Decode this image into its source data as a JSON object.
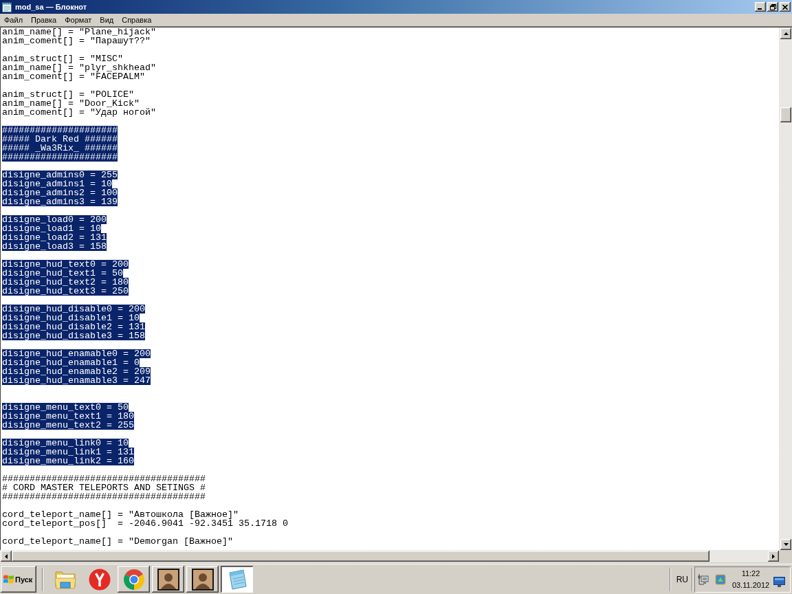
{
  "window": {
    "title": "mod_sa — Блокнот"
  },
  "menu": [
    "Файл",
    "Правка",
    "Формат",
    "Вид",
    "Справка"
  ],
  "editor": {
    "lines": [
      {
        "kind": "text",
        "text": "anim_name[] = \"Plane_hijack\"",
        "selected": false
      },
      {
        "kind": "text",
        "text": "anim_coment[] = \"Парашут??\"",
        "selected": false
      },
      {
        "kind": "blank"
      },
      {
        "kind": "text",
        "text": "anim_struct[] = \"MISC\"",
        "selected": false
      },
      {
        "kind": "text",
        "text": "anim_name[] = \"plyr_shkhead\"",
        "selected": false
      },
      {
        "kind": "text",
        "text": "anim_coment[] = \"FACEPALM\"",
        "selected": false
      },
      {
        "kind": "blank"
      },
      {
        "kind": "text",
        "text": "anim_struct[] = \"POLICE\"",
        "selected": false
      },
      {
        "kind": "text",
        "text": "anim_name[] = \"Door_Kick\"",
        "selected": false
      },
      {
        "kind": "text",
        "text": "anim_coment[] = \"Удар ногой\"",
        "selected": false
      },
      {
        "kind": "blank"
      },
      {
        "kind": "text",
        "text": "#####################",
        "selected": true
      },
      {
        "kind": "text",
        "text": "##### Dark Red ######",
        "selected": true
      },
      {
        "kind": "text",
        "text": "##### _Wa3Rix_ ######",
        "selected": true
      },
      {
        "kind": "text",
        "text": "#####################",
        "selected": true
      },
      {
        "kind": "blank"
      },
      {
        "kind": "text",
        "text": "disigne_admins0 = 255",
        "selected": true
      },
      {
        "kind": "text",
        "text": "disigne_admins1 = 10",
        "selected": true
      },
      {
        "kind": "text",
        "text": "disigne_admins2 = 100",
        "selected": true
      },
      {
        "kind": "text",
        "text": "disigne_admins3 = 139",
        "selected": true
      },
      {
        "kind": "blank"
      },
      {
        "kind": "text",
        "text": "disigne_load0 = 200",
        "selected": true
      },
      {
        "kind": "text",
        "text": "disigne_load1 = 10",
        "selected": true
      },
      {
        "kind": "text",
        "text": "disigne_load2 = 131",
        "selected": true
      },
      {
        "kind": "text",
        "text": "disigne_load3 = 158",
        "selected": true
      },
      {
        "kind": "blank"
      },
      {
        "kind": "text",
        "text": "disigne_hud_text0 = 200",
        "selected": true
      },
      {
        "kind": "text",
        "text": "disigne_hud_text1 = 50",
        "selected": true
      },
      {
        "kind": "text",
        "text": "disigne_hud_text2 = 180",
        "selected": true
      },
      {
        "kind": "text",
        "text": "disigne_hud_text3 = 250",
        "selected": true
      },
      {
        "kind": "blank"
      },
      {
        "kind": "text",
        "text": "disigne_hud_disable0 = 200",
        "selected": true
      },
      {
        "kind": "text",
        "text": "disigne_hud_disable1 = 10",
        "selected": true
      },
      {
        "kind": "text",
        "text": "disigne_hud_disable2 = 131",
        "selected": true
      },
      {
        "kind": "text",
        "text": "disigne_hud_disable3 = 158",
        "selected": true
      },
      {
        "kind": "blank"
      },
      {
        "kind": "text",
        "text": "disigne_hud_enamable0 = 200",
        "selected": true
      },
      {
        "kind": "text",
        "text": "disigne_hud_enamable1 = 0",
        "selected": true
      },
      {
        "kind": "text",
        "text": "disigne_hud_enamable2 = 209",
        "selected": true
      },
      {
        "kind": "text",
        "text": "disigne_hud_enamable3 = 247",
        "selected": true
      },
      {
        "kind": "blank"
      },
      {
        "kind": "blank"
      },
      {
        "kind": "text",
        "text": "disigne_menu_text0 = 50",
        "selected": true
      },
      {
        "kind": "text",
        "text": "disigne_menu_text1 = 180",
        "selected": true
      },
      {
        "kind": "text",
        "text": "disigne_menu_text2 = 255",
        "selected": true
      },
      {
        "kind": "blank"
      },
      {
        "kind": "text",
        "text": "disigne_menu_link0 = 10",
        "selected": true
      },
      {
        "kind": "text",
        "text": "disigne_menu_link1 = 131",
        "selected": true
      },
      {
        "kind": "text",
        "text": "disigne_menu_link2 = 160",
        "selected": true
      },
      {
        "kind": "blank"
      },
      {
        "kind": "text",
        "text": "#####################################",
        "selected": false
      },
      {
        "kind": "text",
        "text": "# CORD MASTER TELEPORTS AND SETINGS #",
        "selected": false
      },
      {
        "kind": "text",
        "text": "#####################################",
        "selected": false
      },
      {
        "kind": "blank"
      },
      {
        "kind": "text",
        "text": "cord_teleport_name[] = \"Автошкола [Важное]\"",
        "selected": false
      },
      {
        "kind": "text",
        "text": "cord_teleport_pos[]  = -2046.9041 -92.3451 35.1718 0",
        "selected": false
      },
      {
        "kind": "blank"
      },
      {
        "kind": "text",
        "text": "cord_teleport_name[] = \"Demorgan [Важное]\"",
        "selected": false
      }
    ]
  },
  "taskbar": {
    "start_button": {
      "label": "Пуск"
    },
    "apps": [
      {
        "kind": "folder",
        "running": false,
        "selected": false
      },
      {
        "kind": "y-browser",
        "running": false,
        "selected": false
      },
      {
        "kind": "ring-browser",
        "running": true,
        "selected": false
      },
      {
        "kind": "game",
        "running": true,
        "selected": false
      },
      {
        "kind": "game",
        "running": true,
        "selected": false
      },
      {
        "kind": "notepad",
        "running": true,
        "selected": true
      }
    ],
    "language": "RU",
    "clock": {
      "time": "11:22",
      "date": "03.11.2012"
    }
  }
}
